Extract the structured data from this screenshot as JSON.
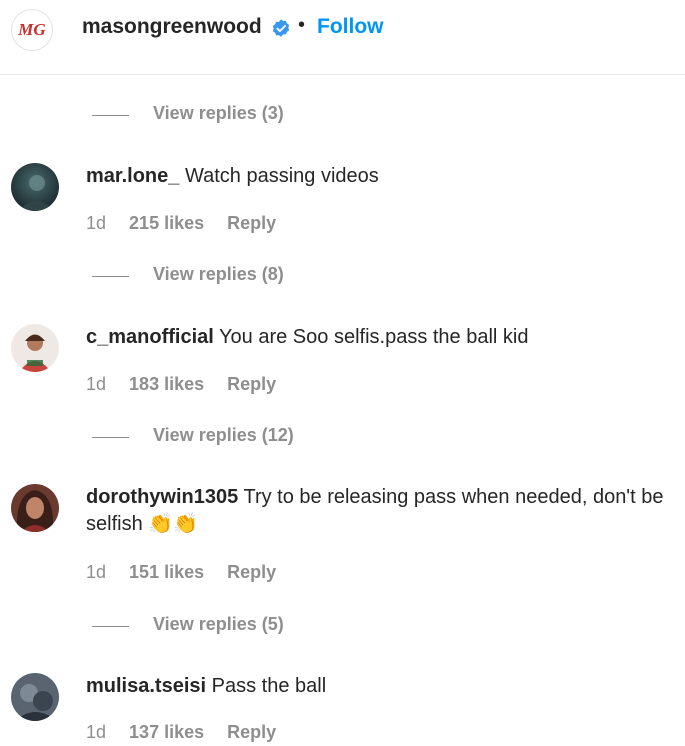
{
  "header": {
    "logo_text": "MG",
    "username": "masongreenwood",
    "separator": "•",
    "follow_label": "Follow",
    "accent_color": "#0095f6"
  },
  "replies": [
    {
      "label": "View replies (3)"
    },
    {
      "label": "View replies (8)"
    },
    {
      "label": "View replies (12)"
    },
    {
      "label": "View replies (5)"
    }
  ],
  "comments": [
    {
      "username": "mar.lone_",
      "text": "Watch passing videos",
      "time": "1d",
      "likes": "215 likes",
      "reply_label": "Reply"
    },
    {
      "username": "c_manofficial",
      "text": "You are Soo selfis.pass the ball kid",
      "time": "1d",
      "likes": "183 likes",
      "reply_label": "Reply"
    },
    {
      "username": "dorothywin1305",
      "text": "Try to be releasing pass when needed, don't be selfish 👏👏",
      "time": "1d",
      "likes": "151 likes",
      "reply_label": "Reply"
    },
    {
      "username": "mulisa.tseisi",
      "text": "Pass the ball",
      "time": "1d",
      "likes": "137 likes",
      "reply_label": "Reply"
    }
  ]
}
